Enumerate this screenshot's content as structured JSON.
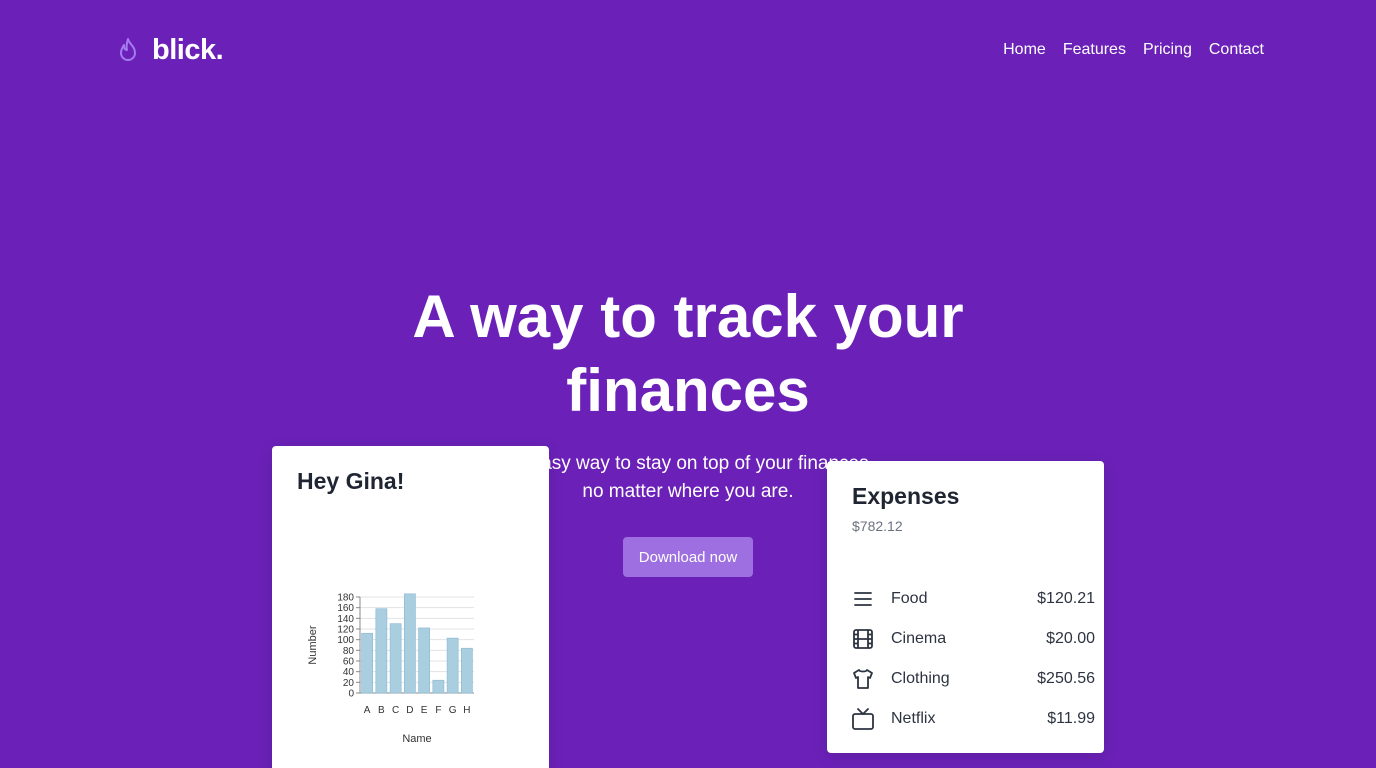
{
  "brand": {
    "name": "blick.",
    "icon": "flame-icon"
  },
  "nav": {
    "items": [
      "Home",
      "Features",
      "Pricing",
      "Contact"
    ]
  },
  "hero": {
    "title": "A way to track your finances",
    "subtitle_line1": "An easy way to stay on top of your finances,",
    "subtitle_line2": "no matter where you are.",
    "cta_label": "Download now"
  },
  "greeting_card": {
    "title": "Hey Gina!"
  },
  "chart_data": {
    "type": "bar",
    "categories": [
      "A",
      "B",
      "C",
      "D",
      "E",
      "F",
      "G",
      "H"
    ],
    "values": [
      112,
      158,
      130,
      186,
      122,
      24,
      103,
      84
    ],
    "xlabel": "Name",
    "ylabel": "Number",
    "ylim": [
      0,
      180
    ],
    "yticks": [
      0,
      20,
      40,
      60,
      80,
      100,
      120,
      140,
      160,
      180
    ],
    "grid": true,
    "bar_color": "#a8cee0"
  },
  "expenses": {
    "title": "Expenses",
    "total": "$782.12",
    "items": [
      {
        "name": "Food",
        "amount": "$120.21",
        "icon": "menu-lines-icon"
      },
      {
        "name": "Cinema",
        "amount": "$20.00",
        "icon": "film-icon"
      },
      {
        "name": "Clothing",
        "amount": "$250.56",
        "icon": "shirt-icon"
      },
      {
        "name": "Netflix",
        "amount": "$11.99",
        "icon": "tv-icon"
      }
    ]
  },
  "colors": {
    "background": "#6b21b8",
    "button": "#9d6fe0",
    "brand_icon": "#a57bf0"
  }
}
